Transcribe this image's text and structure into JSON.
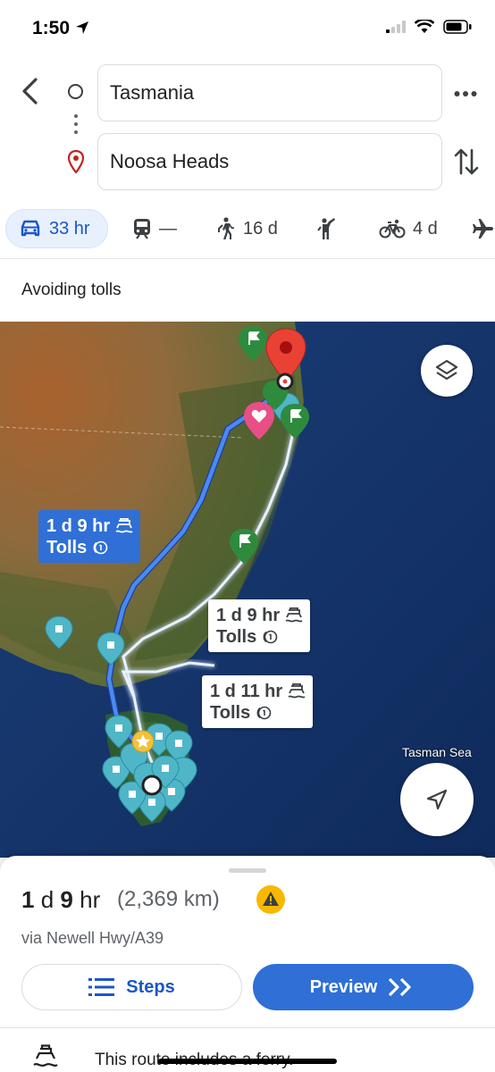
{
  "status": {
    "time": "1:50"
  },
  "search": {
    "origin": "Tasmania",
    "destination": "Noosa Heads"
  },
  "modes": [
    {
      "icon": "car-icon",
      "label": "33 hr",
      "active": true
    },
    {
      "icon": "transit-icon",
      "label": "—"
    },
    {
      "icon": "walk-icon",
      "label": "16 d"
    },
    {
      "icon": "ride-hail-icon",
      "label": ""
    },
    {
      "icon": "bike-icon",
      "label": "4 d"
    },
    {
      "icon": "plane-icon",
      "label": ""
    }
  ],
  "options": {
    "avoiding": "Avoiding tolls"
  },
  "map": {
    "sea_label": "Tasman Sea",
    "routes": [
      {
        "duration": "1 d 9 hr",
        "tolls": "Tolls",
        "selected": true
      },
      {
        "duration": "1 d 9 hr",
        "tolls": "Tolls",
        "selected": false
      },
      {
        "duration": "1 d 11 hr",
        "tolls": "Tolls",
        "selected": false
      }
    ]
  },
  "summary": {
    "duration_num1": "1",
    "duration_unit1": "d",
    "duration_num2": "9",
    "duration_unit2": "hr",
    "distance": "(2,369 km)",
    "via": "via Newell Hwy/A39",
    "steps_label": "Steps",
    "preview_label": "Preview",
    "ferry_note": "This route includes a ferry."
  },
  "colors": {
    "accent": "#2f6fd6",
    "route_alt": "#cfe0ff",
    "pin_red": "#e94235",
    "pin_teal": "#4fb6c8",
    "pin_green": "#2e8b3e",
    "pin_pink": "#e84f86"
  }
}
